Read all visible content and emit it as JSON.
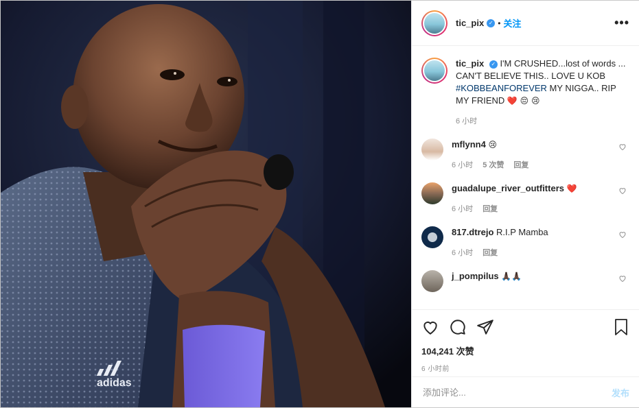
{
  "post_header": {
    "username": "tic_pix",
    "separator": "•",
    "follow_label": "关注",
    "more_label": "•••"
  },
  "caption": {
    "username": "tic_pix",
    "text_1": "I'M CRUSHED...lost of words ... CAN'T BELIEVE THIS.. LOVE U KOB ",
    "hashtag": "#KOBBEANFOREVER",
    "text_2": " MY NIGGA.. RIP MY FRIEND ",
    "emojis": "❤️ 😔 😢",
    "time": "6 小时"
  },
  "comments": [
    {
      "username": "mflynn4",
      "text": "😢",
      "time": "6 小时",
      "likes": "5 次赞",
      "reply": "回复"
    },
    {
      "username": "guadalupe_river_outfitters",
      "text": "❤️",
      "time": "6 小时",
      "reply": "回复"
    },
    {
      "username": "817.dtrejo",
      "text": "R.I.P Mamba",
      "time": "6 小时",
      "reply": "回复"
    },
    {
      "username": "j_pompilus",
      "text": "🙏🏿🙏🏿",
      "time": "",
      "reply": ""
    }
  ],
  "actions": {
    "likes_count": "104,241 次赞",
    "posted_time": "6 小时前"
  },
  "add_comment": {
    "placeholder": "添加评论...",
    "post_label": "发布"
  },
  "photo": {
    "sleeve_text": "adidas"
  },
  "colors": {
    "accent": "#0095f6",
    "verified": "#3897f0",
    "heart_red": "#ed4956",
    "muted": "#8e8e8e"
  }
}
